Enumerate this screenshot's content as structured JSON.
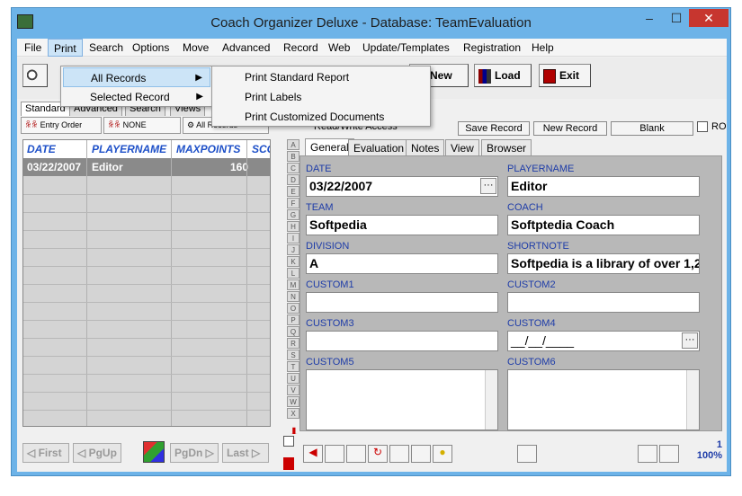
{
  "window": {
    "title": "Coach Organizer Deluxe - Database: TeamEvaluation"
  },
  "menu": [
    "File",
    "Print",
    "Search",
    "Options",
    "Move",
    "Advanced",
    "Record",
    "Web",
    "Update/Templates",
    "Registration",
    "Help"
  ],
  "toolbar": {
    "new": "New",
    "load": "Load",
    "exit": "Exit"
  },
  "print_menu": {
    "all_records": "All Records",
    "selected_record": "Selected Record"
  },
  "print_submenu": [
    "Print Standard Report",
    "Print Labels",
    "Print Customized Documents"
  ],
  "left_tabs": [
    "Standard",
    "Advanced",
    "Search",
    "Views"
  ],
  "sort": {
    "entry_order": "Entry Order",
    "none": "NONE",
    "all_records": "All Records"
  },
  "grid": {
    "columns": [
      "DATE",
      "PLAYERNAME",
      "MAXPOINTS",
      "SCO"
    ],
    "row": {
      "date": "03/22/2007",
      "player": "Editor",
      "max": "160"
    }
  },
  "alphabet": [
    "A",
    "B",
    "C",
    "D",
    "E",
    "F",
    "G",
    "H",
    "I",
    "J",
    "K",
    "L",
    "M",
    "N",
    "O",
    "P",
    "Q",
    "R",
    "S",
    "T",
    "U",
    "V",
    "W",
    "X"
  ],
  "right_top": {
    "access": "Read/Write Access",
    "save": "Save Record",
    "new": "New Record",
    "blank": "Blank",
    "ro": "RO"
  },
  "tabs": [
    "General",
    "Evaluation",
    "Notes",
    "View",
    "Browser"
  ],
  "fields": {
    "date": {
      "label": "DATE",
      "value": "03/22/2007"
    },
    "playername": {
      "label": "PLAYERNAME",
      "value": "Editor"
    },
    "team": {
      "label": "TEAM",
      "value": "Softpedia"
    },
    "coach": {
      "label": "COACH",
      "value": "Softptedia Coach"
    },
    "division": {
      "label": "DIVISION",
      "value": "A"
    },
    "shortnote": {
      "label": "SHORTNOTE",
      "value": "Softpedia is a library of over 1,20"
    },
    "custom1": {
      "label": "CUSTOM1",
      "value": ""
    },
    "custom2": {
      "label": "CUSTOM2",
      "value": ""
    },
    "custom3": {
      "label": "CUSTOM3",
      "value": ""
    },
    "custom4": {
      "label": "CUSTOM4",
      "value": "__/__/____"
    },
    "custom5": {
      "label": "CUSTOM5"
    },
    "custom6": {
      "label": "CUSTOM6"
    }
  },
  "nav": {
    "first": "First",
    "pgup": "PgUp",
    "pgdn": "PgDn",
    "last": "Last"
  },
  "status": {
    "record": "1",
    "zoom": "100%"
  },
  "ellipsis": "···"
}
